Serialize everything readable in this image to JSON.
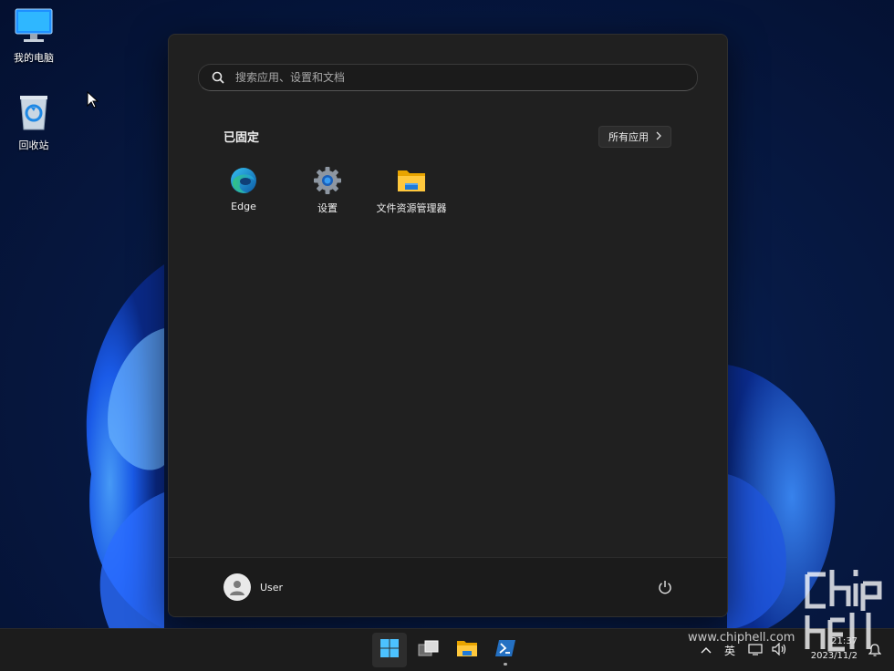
{
  "desktop": {
    "icons": [
      {
        "label": "我的电脑",
        "icon": "monitor-icon"
      },
      {
        "label": "回收站",
        "icon": "recycle-bin-icon"
      }
    ]
  },
  "start_menu": {
    "search": {
      "placeholder": "搜索应用、设置和文档"
    },
    "pinned_title": "已固定",
    "all_apps_label": "所有应用",
    "pinned_apps": [
      {
        "label": "Edge",
        "icon": "edge-icon"
      },
      {
        "label": "设置",
        "icon": "settings-gear-icon"
      },
      {
        "label": "文件资源管理器",
        "icon": "file-explorer-folder-icon"
      }
    ],
    "user": {
      "name": "User"
    }
  },
  "taskbar": {
    "apps": [
      "start-icon",
      "task-view-icon",
      "file-explorer-icon",
      "powershell-icon"
    ],
    "tray": {
      "ime": "英"
    },
    "clock": {
      "time": "21:37",
      "date": "2023/11/2"
    }
  },
  "watermark": {
    "text": "www.chiphell.com",
    "logo_text": "chip hell"
  },
  "colors": {
    "accent": "#0078d4",
    "start_bg": "#202020",
    "taskbar_bg": "#1c1c1c"
  }
}
